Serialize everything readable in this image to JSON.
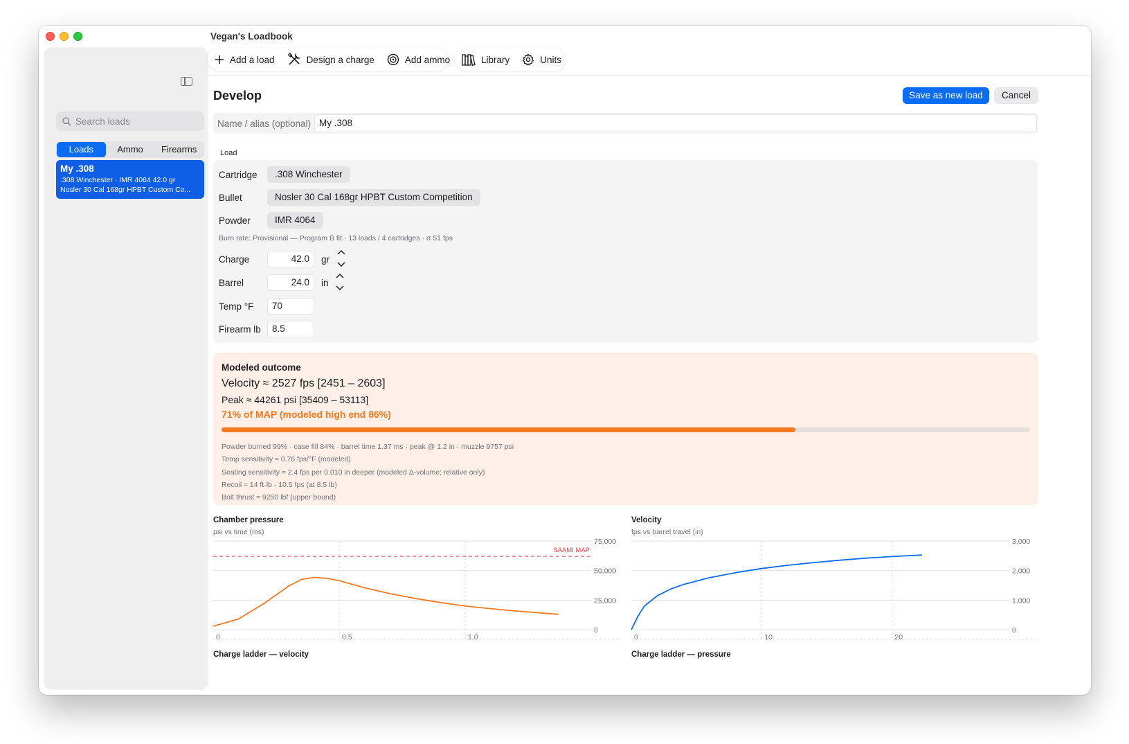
{
  "window": {
    "title": "Vegan's Loadbook"
  },
  "sidebar": {
    "search_placeholder": "Search loads",
    "segments": [
      "Loads",
      "Ammo",
      "Firearms"
    ],
    "active_segment": "Loads",
    "items": [
      {
        "title": "My .308",
        "line1": ".308 Winchester · IMR 4064 42.0 gr",
        "line2": "Nosler 30 Cal 168gr HPBT Custom Co..."
      }
    ]
  },
  "toolbar": {
    "add_load": "Add a load",
    "design_charge": "Design a charge",
    "add_ammo": "Add ammo",
    "library": "Library",
    "units": "Units"
  },
  "develop": {
    "title": "Develop",
    "save_label": "Save as new load",
    "cancel_label": "Cancel",
    "name_label": "Name / alias (optional)",
    "name_value": "My .308",
    "section_label": "Load",
    "cartridge_label": "Cartridge",
    "cartridge_value": ".308 Winchester",
    "bullet_label": "Bullet",
    "bullet_value": "Nosler 30 Cal 168gr HPBT Custom Competition",
    "powder_label": "Powder",
    "powder_value": "IMR 4064",
    "burn_rate": "Burn rate: Provisional — Program B fit · 13 loads / 4 cartridges · σ 51 fps",
    "charge_label": "Charge",
    "charge_value": "42.0",
    "charge_unit": "gr",
    "barrel_label": "Barrel",
    "barrel_value": "24.0",
    "barrel_unit": "in",
    "temp_label": "Temp °F",
    "temp_value": "70",
    "firearm_label": "Firearm lb",
    "firearm_value": "8.5"
  },
  "outcome": {
    "title": "Modeled outcome",
    "velocity": "Velocity ≈ 2527 fps   [2451 – 2603]",
    "peak": "Peak ≈ 44261 psi   [35409 – 53113]",
    "map_text": "71% of MAP (modeled high end 86%)",
    "map_fraction": 0.71,
    "details": [
      "Powder burned 99%  ·  case fill 84%  ·  barrel time 1.37 ms  ·  peak @ 1.2 in  ·  muzzle 9757 psi",
      "Temp sensitivity ≈ 0.76 fps/°F (modeled)",
      "Seating sensitivity ≈ 2.4 fps per 0.010 in deeper (modeled Δ-volume; relative only)",
      "Recoil ≈ 14 ft·lb · 10.5 fps  (at 8.5 lb)",
      "Bolt thrust ≈ 9250 lbf (upper bound)"
    ],
    "accent": "#f5791f"
  },
  "chart_data": [
    {
      "type": "line",
      "title": "Chamber pressure",
      "subtitle": "psi vs time (ms)",
      "x_ticks": [
        "0",
        "0.5",
        "1.0"
      ],
      "y_ticks": [
        "75,000",
        "50,000",
        "25,000",
        "0"
      ],
      "xlim": [
        0,
        1.5
      ],
      "ylim": [
        0,
        75000
      ],
      "reference_line": {
        "label": "SAAMI MAP",
        "y": 62000,
        "color": "#e8434b"
      },
      "series": [
        {
          "color": "#f5791f",
          "x": [
            0,
            0.1,
            0.2,
            0.3,
            0.35,
            0.4,
            0.45,
            0.5,
            0.6,
            0.7,
            0.8,
            0.9,
            1.0,
            1.1,
            1.2,
            1.37
          ],
          "y": [
            3000,
            9000,
            22000,
            37000,
            42500,
            44261,
            43500,
            41500,
            35500,
            30500,
            26500,
            23000,
            20000,
            17800,
            15800,
            13000
          ]
        }
      ]
    },
    {
      "type": "line",
      "title": "Velocity",
      "subtitle": "fps vs barrel travel (in)",
      "x_ticks": [
        "0",
        "10",
        "20"
      ],
      "y_ticks": [
        "3,000",
        "2,000",
        "1,000",
        "0"
      ],
      "xlim": [
        0,
        29
      ],
      "ylim": [
        0,
        3000
      ],
      "series": [
        {
          "color": "#0a6cf0",
          "x": [
            0,
            0.2,
            0.5,
            1,
            2,
            3,
            4,
            6,
            8,
            10,
            12,
            14,
            16,
            18,
            20,
            22.3
          ],
          "y": [
            0,
            180,
            450,
            800,
            1150,
            1370,
            1530,
            1760,
            1930,
            2070,
            2180,
            2270,
            2350,
            2420,
            2475,
            2527
          ]
        }
      ]
    }
  ],
  "bottom_charts": {
    "left_title": "Charge ladder — velocity",
    "right_title": "Charge ladder — pressure"
  }
}
